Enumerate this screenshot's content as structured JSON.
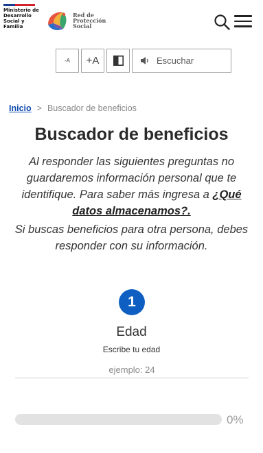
{
  "header": {
    "ministry_lines": [
      "Ministerio de",
      "Desarrollo",
      "Social y",
      "Familia"
    ],
    "brand_lines": [
      "Red de",
      "Protección",
      "Social"
    ]
  },
  "toolbar": {
    "decrease_label": "-A",
    "increase_label": "+A",
    "listen_label": "Escuchar"
  },
  "breadcrumb": {
    "home": "Inicio",
    "separator": ">",
    "current": "Buscador de beneficios"
  },
  "main": {
    "title": "Buscador de beneficios",
    "intro_text": "Al responder las siguientes preguntas no guardaremos información personal que te identifique. Para saber más ingresa a ",
    "intro_link": "¿Qué datos almacenamos?.",
    "intro2": "Si buscas beneficios para otra persona, debes responder con su información."
  },
  "question": {
    "number": "1",
    "label": "Edad",
    "hint": "Escribe tu edad",
    "placeholder": "ejemplo: 24",
    "value": ""
  },
  "progress": {
    "percent": 0,
    "label": "0%"
  },
  "colors": {
    "primary": "#0f5fc2",
    "link": "#0f4cb0",
    "ministry_blue": "#1a3a8f",
    "ministry_red": "#d2232a"
  },
  "icons": [
    "rps-logo-icon",
    "search-icon",
    "menu-icon",
    "contrast-icon",
    "speaker-icon"
  ]
}
